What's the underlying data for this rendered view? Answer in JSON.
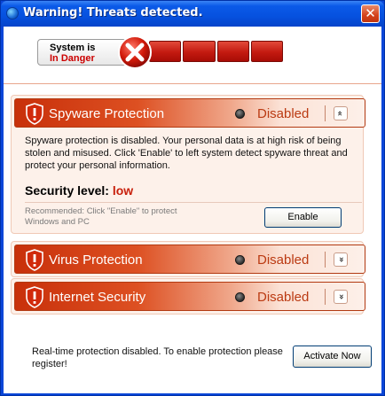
{
  "window": {
    "title": "Warning! Threats detected.",
    "close_glyph": "✕"
  },
  "system_status": {
    "line1": "System is",
    "line2": "In Danger",
    "danger_icon": "red-x-icon",
    "level_cells": 4
  },
  "panels": [
    {
      "title": "Spyware Protection",
      "status": "Disabled",
      "expanded": true,
      "chevron": "»",
      "description": "Spyware protection is disabled. Your personal data is at high risk of being stolen and misused. Click 'Enable' to left system detect spyware threat and protect your personal information.",
      "security_level_label": "Security level:",
      "security_level_value": "low",
      "recommendation": "Recommended: Click \"Enable\" to protect Windows and PC",
      "button_label": "Enable"
    },
    {
      "title": "Virus Protection",
      "status": "Disabled",
      "expanded": false,
      "chevron": "»"
    },
    {
      "title": "Internet Security",
      "status": "Disabled",
      "expanded": false,
      "chevron": "»"
    }
  ],
  "footer": {
    "message": "Real-time protection disabled. To enable protection please register!",
    "button_label": "Activate Now"
  },
  "colors": {
    "title_bar": "#0651df",
    "danger_red": "#c31a10",
    "header_orange": "#dd5022",
    "status_text": "#bb3a12"
  }
}
